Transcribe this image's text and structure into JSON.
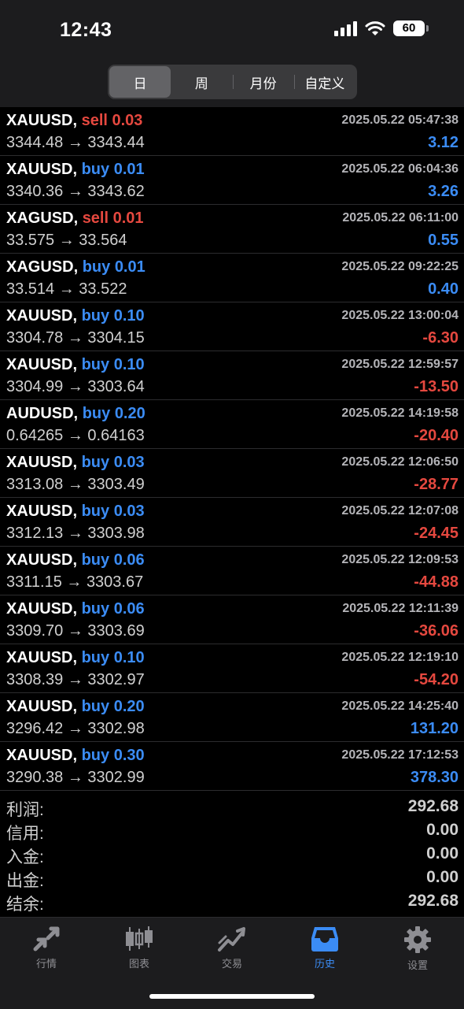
{
  "status": {
    "time": "12:43",
    "battery": "60"
  },
  "segments": [
    {
      "label": "日",
      "selected": true
    },
    {
      "label": "周",
      "selected": false
    },
    {
      "label": "月份",
      "selected": false
    },
    {
      "label": "自定义",
      "selected": false
    }
  ],
  "trades": [
    {
      "symbol": "XAUUSD,",
      "side": "sell",
      "lot": "0.03",
      "time": "2025.05.22 05:47:38",
      "open": "3344.48",
      "close": "3343.44",
      "profit": "3.12"
    },
    {
      "symbol": "XAUUSD,",
      "side": "buy",
      "lot": "0.01",
      "time": "2025.05.22 06:04:36",
      "open": "3340.36",
      "close": "3343.62",
      "profit": "3.26"
    },
    {
      "symbol": "XAGUSD,",
      "side": "sell",
      "lot": "0.01",
      "time": "2025.05.22 06:11:00",
      "open": "33.575",
      "close": "33.564",
      "profit": "0.55"
    },
    {
      "symbol": "XAGUSD,",
      "side": "buy",
      "lot": "0.01",
      "time": "2025.05.22 09:22:25",
      "open": "33.514",
      "close": "33.522",
      "profit": "0.40"
    },
    {
      "symbol": "XAUUSD,",
      "side": "buy",
      "lot": "0.10",
      "time": "2025.05.22 13:00:04",
      "open": "3304.78",
      "close": "3304.15",
      "profit": "-6.30"
    },
    {
      "symbol": "XAUUSD,",
      "side": "buy",
      "lot": "0.10",
      "time": "2025.05.22 12:59:57",
      "open": "3304.99",
      "close": "3303.64",
      "profit": "-13.50"
    },
    {
      "symbol": "AUDUSD,",
      "side": "buy",
      "lot": "0.20",
      "time": "2025.05.22 14:19:58",
      "open": "0.64265",
      "close": "0.64163",
      "profit": "-20.40"
    },
    {
      "symbol": "XAUUSD,",
      "side": "buy",
      "lot": "0.03",
      "time": "2025.05.22 12:06:50",
      "open": "3313.08",
      "close": "3303.49",
      "profit": "-28.77"
    },
    {
      "symbol": "XAUUSD,",
      "side": "buy",
      "lot": "0.03",
      "time": "2025.05.22 12:07:08",
      "open": "3312.13",
      "close": "3303.98",
      "profit": "-24.45"
    },
    {
      "symbol": "XAUUSD,",
      "side": "buy",
      "lot": "0.06",
      "time": "2025.05.22 12:09:53",
      "open": "3311.15",
      "close": "3303.67",
      "profit": "-44.88"
    },
    {
      "symbol": "XAUUSD,",
      "side": "buy",
      "lot": "0.06",
      "time": "2025.05.22 12:11:39",
      "open": "3309.70",
      "close": "3303.69",
      "profit": "-36.06"
    },
    {
      "symbol": "XAUUSD,",
      "side": "buy",
      "lot": "0.10",
      "time": "2025.05.22 12:19:10",
      "open": "3308.39",
      "close": "3302.97",
      "profit": "-54.20"
    },
    {
      "symbol": "XAUUSD,",
      "side": "buy",
      "lot": "0.20",
      "time": "2025.05.22 14:25:40",
      "open": "3296.42",
      "close": "3302.98",
      "profit": "131.20"
    },
    {
      "symbol": "XAUUSD,",
      "side": "buy",
      "lot": "0.30",
      "time": "2025.05.22 17:12:53",
      "open": "3290.38",
      "close": "3302.99",
      "profit": "378.30"
    }
  ],
  "summary": [
    {
      "label": "利润:",
      "value": "292.68"
    },
    {
      "label": "信用:",
      "value": "0.00"
    },
    {
      "label": "入金:",
      "value": "0.00"
    },
    {
      "label": "出金:",
      "value": "0.00"
    },
    {
      "label": "结余:",
      "value": "292.68"
    }
  ],
  "tabs": [
    {
      "label": "行情",
      "icon": "quotes-icon",
      "active": false
    },
    {
      "label": "图表",
      "icon": "chart-icon",
      "active": false
    },
    {
      "label": "交易",
      "icon": "trade-icon",
      "active": false
    },
    {
      "label": "历史",
      "icon": "history-icon",
      "active": true
    },
    {
      "label": "设置",
      "icon": "settings-icon",
      "active": false
    }
  ],
  "colors": {
    "sell": "#e5483f",
    "buy": "#3b8cf5",
    "active_tab": "#3b8cf5",
    "inactive_tab": "#8e8e93"
  }
}
